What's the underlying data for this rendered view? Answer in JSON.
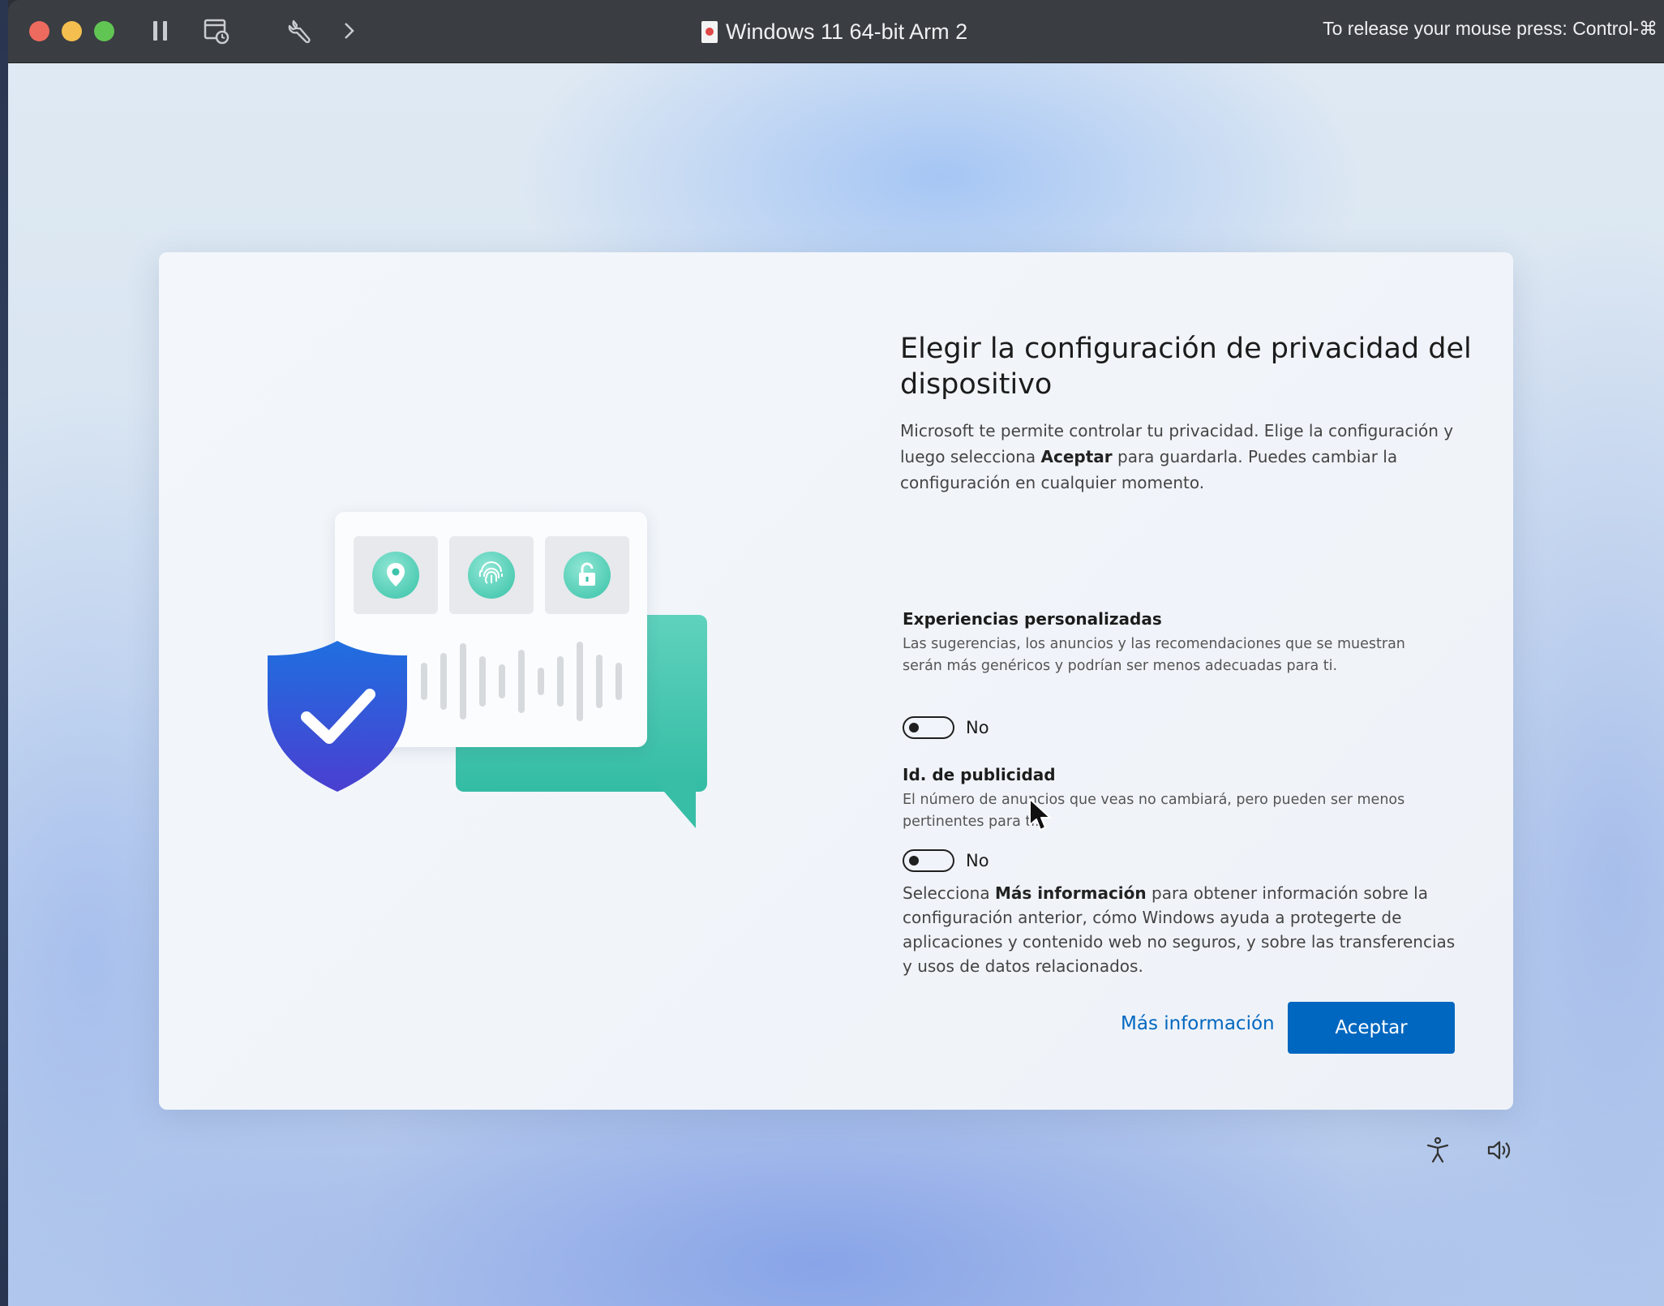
{
  "window": {
    "title": "Windows 11 64-bit Arm 2",
    "release_hint": "To release your mouse press: Control-⌘"
  },
  "toolbar_icons": [
    "pause-icon",
    "snapshot-icon",
    "wrench-icon",
    "chevron-right-icon"
  ],
  "oobe": {
    "heading": "Elegir la configuración de privacidad del dispositivo",
    "intro": {
      "part1": "Microsoft te permite controlar tu privacidad. Elige la configuración y luego selecciona ",
      "bold": "Aceptar",
      "part2": " para guardarla. Puedes cambiar la configuración en cualquier momento."
    },
    "options": [
      {
        "title": "Experiencias personalizadas",
        "description": "Las sugerencias, los anuncios y las recomendaciones que se muestran serán más genéricos y podrían ser menos adecuadas para ti.",
        "state_label": "No"
      },
      {
        "title": "Id. de publicidad",
        "description": "El número de anuncios que veas no cambiará, pero pueden ser menos pertinentes para ti.",
        "state_label": "No"
      }
    ],
    "more_info_text": {
      "part1": "Selecciona ",
      "bold": "Más información",
      "part2": " para obtener información sobre la configuración anterior, cómo Windows ayuda a protegerte de aplicaciones y contenido web no seguros, y sobre las transferencias y usos de datos relacionados."
    },
    "more_info_link": "Más información",
    "accept_button": "Aceptar"
  },
  "colors": {
    "accent": "#0067c0",
    "teal": "#38c2a8",
    "shield_top": "#1f6fe0",
    "shield_bottom": "#4a3fd0"
  }
}
